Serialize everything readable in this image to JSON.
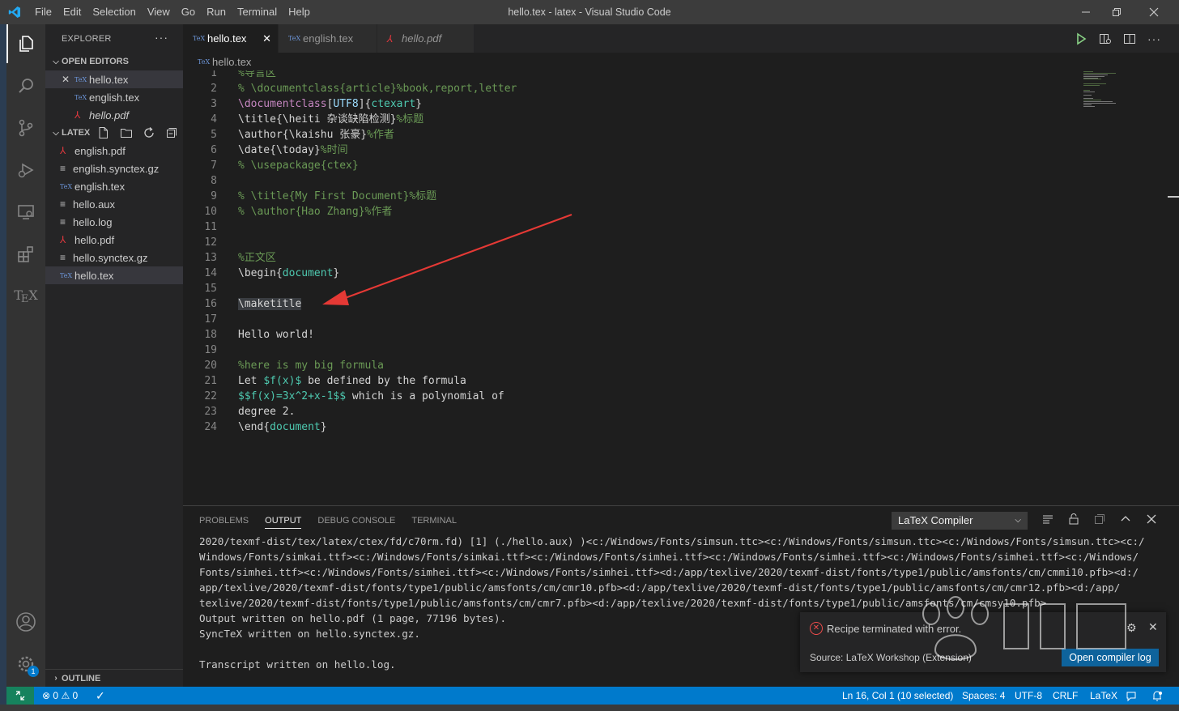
{
  "titlebar": {
    "menu": [
      "File",
      "Edit",
      "Selection",
      "View",
      "Go",
      "Run",
      "Terminal",
      "Help"
    ],
    "title": "hello.tex - latex - Visual Studio Code"
  },
  "sidebar": {
    "header": "EXPLORER",
    "open_editors_label": "OPEN EDITORS",
    "open_editors": [
      {
        "name": "hello.tex",
        "type": "tex"
      },
      {
        "name": "english.tex",
        "type": "tex"
      },
      {
        "name": "hello.pdf",
        "type": "pdf"
      }
    ],
    "folder_label": "LATEX",
    "files": [
      {
        "name": "english.pdf",
        "type": "pdf"
      },
      {
        "name": "english.synctex.gz",
        "type": "file"
      },
      {
        "name": "english.tex",
        "type": "tex"
      },
      {
        "name": "hello.aux",
        "type": "file"
      },
      {
        "name": "hello.log",
        "type": "file"
      },
      {
        "name": "hello.pdf",
        "type": "pdf"
      },
      {
        "name": "hello.synctex.gz",
        "type": "file"
      },
      {
        "name": "hello.tex",
        "type": "tex"
      }
    ],
    "outline_label": "OUTLINE"
  },
  "tabs": [
    {
      "label": "hello.tex",
      "active": true
    },
    {
      "label": "english.tex",
      "active": false
    },
    {
      "label": "hello.pdf",
      "active": false
    }
  ],
  "breadcrumb": "hello.tex",
  "editor": {
    "lines": [
      [
        {
          "t": "%导言区",
          "c": "com"
        }
      ],
      [
        {
          "t": "% \\documentclass{article}%book,report,letter",
          "c": "com"
        }
      ],
      [
        {
          "t": "\\documentclass",
          "c": "kw"
        },
        {
          "t": "[",
          "c": ""
        },
        {
          "t": "UTF8",
          "c": "str"
        },
        {
          "t": "]{",
          "c": ""
        },
        {
          "t": "ctexart",
          "c": "cls"
        },
        {
          "t": "}",
          "c": ""
        }
      ],
      [
        {
          "t": "\\title{\\heiti 杂谈缺陷检测}",
          "c": ""
        },
        {
          "t": "%标题",
          "c": "com"
        }
      ],
      [
        {
          "t": "\\author{\\kaishu 张豪}",
          "c": ""
        },
        {
          "t": "%作者",
          "c": "com"
        }
      ],
      [
        {
          "t": "\\date{\\today}",
          "c": ""
        },
        {
          "t": "%时间",
          "c": "com"
        }
      ],
      [
        {
          "t": "% \\usepackage{ctex}",
          "c": "com"
        }
      ],
      [],
      [
        {
          "t": "% \\title{My First Document}%标题",
          "c": "com"
        }
      ],
      [
        {
          "t": "% \\author{Hao Zhang}%作者",
          "c": "com"
        }
      ],
      [],
      [],
      [
        {
          "t": "%正文区",
          "c": "com"
        }
      ],
      [
        {
          "t": "\\begin{",
          "c": ""
        },
        {
          "t": "document",
          "c": "cls"
        },
        {
          "t": "}",
          "c": ""
        }
      ],
      [],
      [
        {
          "t": "\\maketitle",
          "c": "hl"
        }
      ],
      [],
      [
        {
          "t": "Hello world!",
          "c": ""
        }
      ],
      [],
      [
        {
          "t": "%here is my big formula",
          "c": "com"
        }
      ],
      [
        {
          "t": "Let ",
          "c": ""
        },
        {
          "t": "$f(x)$",
          "c": "cls"
        },
        {
          "t": " be defined by the formula",
          "c": ""
        }
      ],
      [
        {
          "t": "$$f(x)=3x^2+x-1$$",
          "c": "cls"
        },
        {
          "t": " which is a polynomial of",
          "c": ""
        }
      ],
      [
        {
          "t": "degree 2.",
          "c": ""
        }
      ],
      [
        {
          "t": "\\end{",
          "c": ""
        },
        {
          "t": "document",
          "c": "cls"
        },
        {
          "t": "}",
          "c": ""
        }
      ]
    ]
  },
  "panel": {
    "tabs": [
      {
        "label": "PROBLEMS",
        "active": false
      },
      {
        "label": "OUTPUT",
        "active": true
      },
      {
        "label": "DEBUG CONSOLE",
        "active": false
      },
      {
        "label": "TERMINAL",
        "active": false
      }
    ],
    "output_channel": "LaTeX Compiler",
    "output_lines": [
      "2020/texmf-dist/tex/latex/ctex/fd/c70rm.fd) [1] (./hello.aux) )<c:/Windows/Fonts/simsun.ttc><c:/Windows/Fonts/simsun.ttc><c:/Windows/Fonts/simsun.ttc><c:/",
      "Windows/Fonts/simkai.ttf><c:/Windows/Fonts/simkai.ttf><c:/Windows/Fonts/simhei.ttf><c:/Windows/Fonts/simhei.ttf><c:/Windows/Fonts/simhei.ttf><c:/Windows/",
      "Fonts/simhei.ttf><c:/Windows/Fonts/simhei.ttf><c:/Windows/Fonts/simhei.ttf><d:/app/texlive/2020/texmf-dist/fonts/type1/public/amsfonts/cm/cmmi10.pfb><d:/",
      "app/texlive/2020/texmf-dist/fonts/type1/public/amsfonts/cm/cmr10.pfb><d:/app/texlive/2020/texmf-dist/fonts/type1/public/amsfonts/cm/cmr12.pfb><d:/app/",
      "texlive/2020/texmf-dist/fonts/type1/public/amsfonts/cm/cmr7.pfb><d:/app/texlive/2020/texmf-dist/fonts/type1/public/amsfonts/cm/cmsy10.pfb>",
      "Output written on hello.pdf (1 page, 77196 bytes).",
      "SyncTeX written on hello.synctex.gz.",
      "",
      "Transcript written on hello.log."
    ]
  },
  "notification": {
    "message": "Recipe terminated with error.",
    "source": "Source: LaTeX Workshop (Extension)",
    "button": "Open compiler log"
  },
  "statusbar": {
    "errors": "0",
    "warnings": "0",
    "position": "Ln 16, Col 1 (10 selected)",
    "spaces": "Spaces: 4",
    "encoding": "UTF-8",
    "eol": "CRLF",
    "language": "LaTeX"
  },
  "activity_badge": "1",
  "colors": {
    "accent": "#007acc",
    "remote": "#16825d",
    "error": "#f14c4c",
    "arrow": "#e53935"
  }
}
